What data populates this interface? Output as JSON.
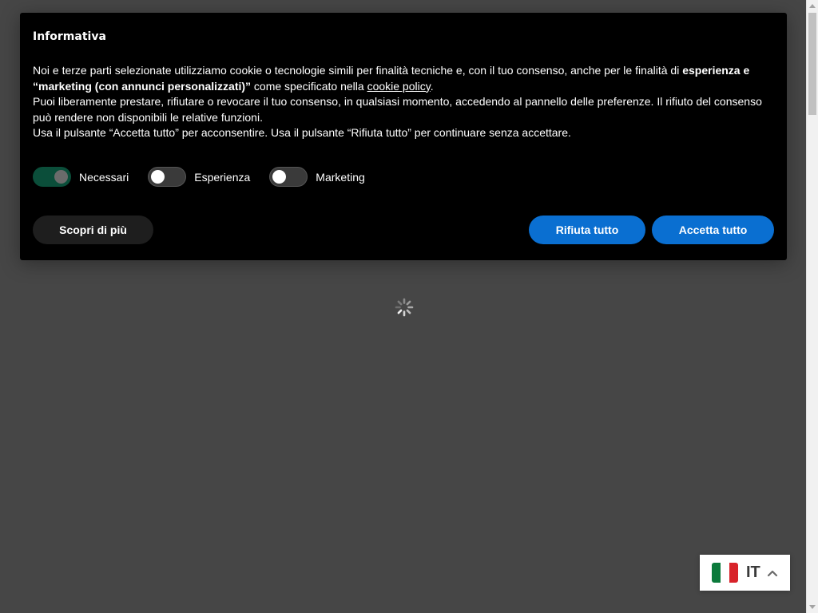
{
  "banner": {
    "title": "Informativa",
    "text": {
      "p1_part1": "Noi e terze parti selezionate utilizziamo cookie o tecnologie simili per finalità tecniche e, con il tuo consenso, anche per le finalità di ",
      "p1_bold": "esperienza e “marketing (con annunci personalizzati)”",
      "p1_part2": " come specificato nella ",
      "p1_link": "cookie policy",
      "p1_part3": ".",
      "p2": "Puoi liberamente prestare, rifiutare o revocare il tuo consenso, in qualsiasi momento, accedendo al pannello delle preferenze. Il rifiuto del consenso può rendere non disponibili le relative funzioni.",
      "p3": "Usa il pulsante “Accetta tutto” per acconsentire. Usa il pulsante “Rifiuta tutto” per continuare senza accettare."
    },
    "toggles": [
      {
        "label": "Necessari",
        "on": true
      },
      {
        "label": "Esperienza",
        "on": false
      },
      {
        "label": "Marketing",
        "on": false
      }
    ],
    "buttons": {
      "more": "Scopri di più",
      "reject": "Rifiuta tutto",
      "accept": "Accetta tutto"
    }
  },
  "colors": {
    "page_bg": "#464646",
    "banner_bg": "#000000",
    "accent_blue": "#0a6fd1",
    "toggle_on": "#0b4e3a"
  },
  "language_selector": {
    "code": "IT",
    "flag_icon": "italy-flag-icon",
    "chevron_icon": "chevron-up-icon"
  }
}
